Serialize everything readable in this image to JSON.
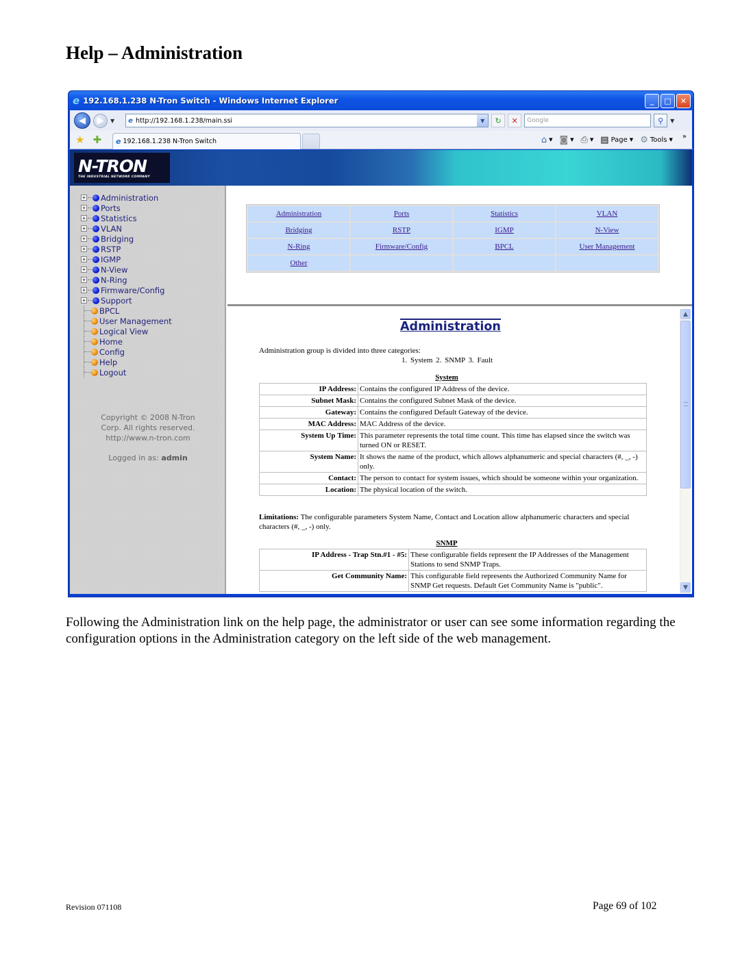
{
  "document": {
    "title": "Help – Administration",
    "caption": "Following the Administration link on the help page, the administrator or user can see some information regarding the configuration options in the Administration category on the left side of the web management.",
    "footer_revision": "Revision 071108",
    "footer_page": "Page 69 of 102"
  },
  "browser": {
    "window_title": "192.168.1.238 N-Tron Switch - Windows Internet Explorer",
    "address": "http://192.168.1.238/main.ssi",
    "search_placeholder": "Google",
    "tab_title": "192.168.1.238 N-Tron Switch",
    "cmd_page": "Page",
    "cmd_tools": "Tools",
    "icons": {
      "back": "◀",
      "forward": "▶",
      "dropdown": "▼",
      "refresh": "↻",
      "stop": "✕",
      "search": "⚲",
      "favorites": "★",
      "add_favorite": "✚",
      "home": "⌂",
      "feeds": "◙",
      "print": "⎙",
      "page": "▤",
      "tools": "⚙",
      "more": "»",
      "minimize": "_",
      "maximize": "□",
      "close": "✕",
      "ie": "e"
    }
  },
  "app": {
    "logo": "N-TRON",
    "logo_tagline": "THE INDUSTRIAL NETWORK COMPANY",
    "sidebar": {
      "expandable_items": [
        "Administration",
        "Ports",
        "Statistics",
        "VLAN",
        "Bridging",
        "RSTP",
        "IGMP",
        "N-View",
        "N-Ring",
        "Firmware/Config",
        "Support"
      ],
      "leaf_items": [
        "BPCL",
        "User Management",
        "Logical View",
        "Home",
        "Config",
        "Help",
        "Logout"
      ],
      "copyright_lines": [
        "Copyright © 2008 N-Tron",
        "Corp. All rights reserved.",
        "http://www.n-tron.com"
      ],
      "logged_in_label": "Logged in as:",
      "logged_in_user": "admin"
    },
    "help_links": [
      [
        "Administration",
        "Ports",
        "Statistics",
        "VLAN"
      ],
      [
        "Bridging",
        "RSTP",
        "IGMP",
        "N-View"
      ],
      [
        "N-Ring",
        "Firmware/Config",
        "BPCL",
        "User Management"
      ],
      [
        "Other",
        "",
        "",
        ""
      ]
    ],
    "help_page": {
      "heading": "Administration",
      "intro": "Administration group is divided into three categories:",
      "categories": "1. System   2. SNMP  3. Fault",
      "system": {
        "heading": "System",
        "rows": [
          {
            "key": "IP Address:",
            "value": "Contains the configured IP Address of the device."
          },
          {
            "key": "Subnet Mask:",
            "value": "Contains the configured Subnet Mask of the device."
          },
          {
            "key": "Gateway:",
            "value": "Contains the configured Default Gateway of the device."
          },
          {
            "key": "MAC Address:",
            "value": "MAC Address of the device."
          },
          {
            "key": "System Up Time:",
            "value": "This parameter represents the total time count. This time has elapsed since the switch was turned ON or RESET."
          },
          {
            "key": "System Name:",
            "value": "It shows the name of the product, which allows alphanumeric and special characters (#, _, -) only."
          },
          {
            "key": "Contact:",
            "value": "The person to contact for system issues, which should be someone within your organization."
          },
          {
            "key": "Location:",
            "value": "The physical location of the switch."
          }
        ]
      },
      "limitations_label": "Limitations:",
      "limitations_text": " The configurable parameters System Name, Contact and Location allow alphanumeric characters and special characters (#, _, -) only.",
      "snmp": {
        "heading": "SNMP",
        "rows": [
          {
            "key": "IP Address - Trap Stn.#1 - #5:",
            "value": "These configurable fields represent the IP Addresses of the Management Stations to send SNMP Traps."
          },
          {
            "key": "Get Community Name:",
            "value": "This configurable field represents the Authorized Community Name for SNMP Get requests. Default Get Community Name is \"public\"."
          }
        ]
      }
    }
  }
}
